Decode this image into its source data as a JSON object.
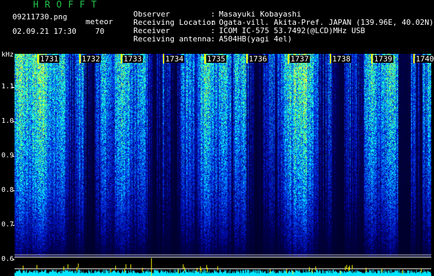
{
  "header": {
    "title": "HROFFT",
    "filename": "09211730.png",
    "capture_type": "meteor",
    "datetime": "02.09.21 17:30",
    "count": "70"
  },
  "meta": [
    {
      "key": "Observer",
      "value": "Masayuki Kobayashi"
    },
    {
      "key": "Receiving Location",
      "value": "Ogata-vill. Akita-Pref. JAPAN (139.96E, 40.02N)"
    },
    {
      "key": "Receiver",
      "value": "ICOM IC-575 53.7492(@LCD)MHz USB"
    },
    {
      "key": "Receiving antenna",
      "value": "A504HB(yagi 4el)"
    }
  ],
  "axis": {
    "unit": "kHz",
    "freq_labels": [
      "1.1",
      "1.0",
      "0.9",
      "0.8",
      "0.7",
      "0.6"
    ],
    "time_labels": [
      "1731",
      "1732",
      "1733",
      "1734",
      "1735",
      "1736",
      "1737",
      "1738",
      "1739",
      "1740"
    ]
  },
  "colors": {
    "title": "#22c24a",
    "background": "#000000",
    "time_marker": "#ffff00",
    "strip": "#00e5ff"
  }
}
